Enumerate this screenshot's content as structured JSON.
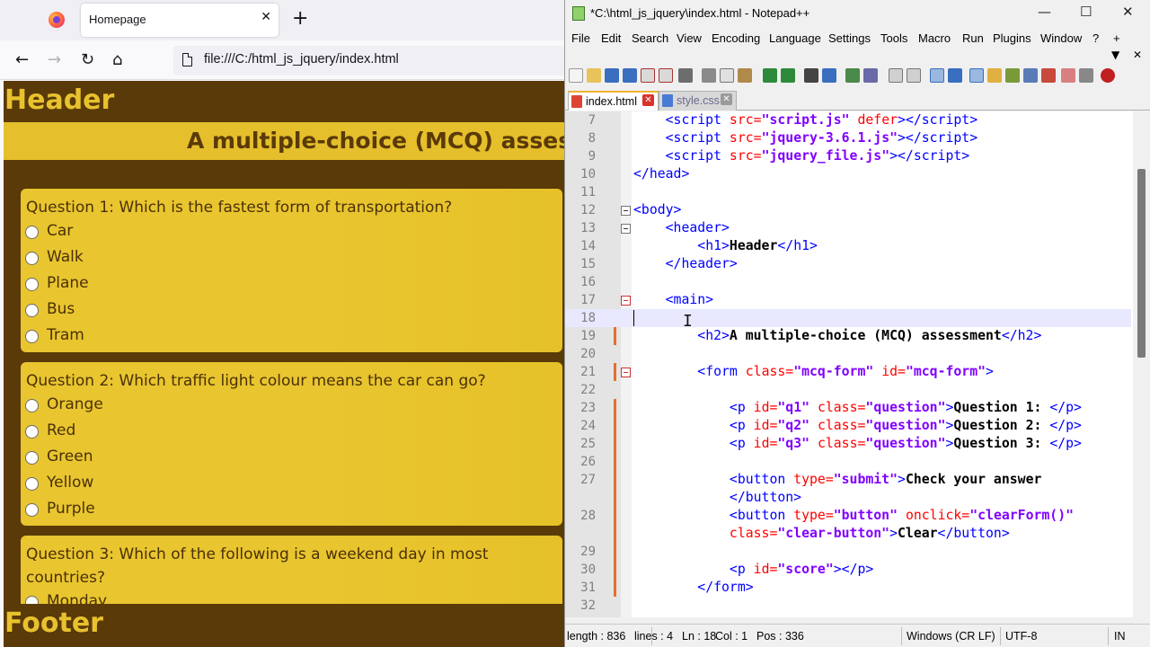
{
  "browser": {
    "tab_title": "Homepage",
    "tab_close": "✕",
    "new_tab": "+",
    "back": "←",
    "forward": "→",
    "reload": "↻",
    "home": "⌂",
    "url": "file:///C:/html_js_jquery/index.html"
  },
  "page": {
    "header": "Header",
    "main_title": "A multiple-choice (MCQ) assess",
    "questions": [
      {
        "text": "Question 1: Which is the fastest form of transportation?",
        "options": [
          "Car",
          "Walk",
          "Plane",
          "Bus",
          "Tram"
        ]
      },
      {
        "text": "Question 2: Which traffic light colour means the car can go?",
        "options": [
          "Orange",
          "Red",
          "Green",
          "Yellow",
          "Purple"
        ]
      },
      {
        "text": "Question 3: Which of the following is a weekend day in most countries?",
        "options": [
          "Monday"
        ]
      }
    ],
    "footer": "Footer",
    "colors": {
      "brown": "#5a3a08",
      "yellow": "#e5bf2c"
    }
  },
  "npp": {
    "title": "*C:\\html_js_jquery\\index.html - Notepad++",
    "window_controls": {
      "minimize": "—",
      "maximize": "☐",
      "close": "✕"
    },
    "menu": [
      "File",
      "Edit",
      "Search",
      "View",
      "Encoding",
      "Language",
      "Settings",
      "Tools",
      "Macro",
      "Run",
      "Plugins",
      "Window",
      "?",
      "+"
    ],
    "menu_extra": {
      "down": "▼",
      "close": "✕"
    },
    "tabs": [
      {
        "label": "index.html",
        "close": "✕"
      },
      {
        "label": "style.css",
        "close": "✕"
      }
    ],
    "line_numbers": [
      "7",
      "8",
      "9",
      "10",
      "11",
      "12",
      "13",
      "14",
      "15",
      "16",
      "17",
      "18",
      "19",
      "20",
      "21",
      "22",
      "23",
      "24",
      "25",
      "26",
      "27",
      "",
      "28",
      "",
      "29",
      "30",
      "31",
      "32"
    ],
    "status": {
      "length": "length : 836",
      "lines": "lines : 4",
      "ln": "Ln : 18",
      "col": "Col : 1",
      "pos": "Pos : 336",
      "eol": "Windows (CR LF)",
      "encoding": "UTF-8",
      "ins": "IN"
    }
  }
}
